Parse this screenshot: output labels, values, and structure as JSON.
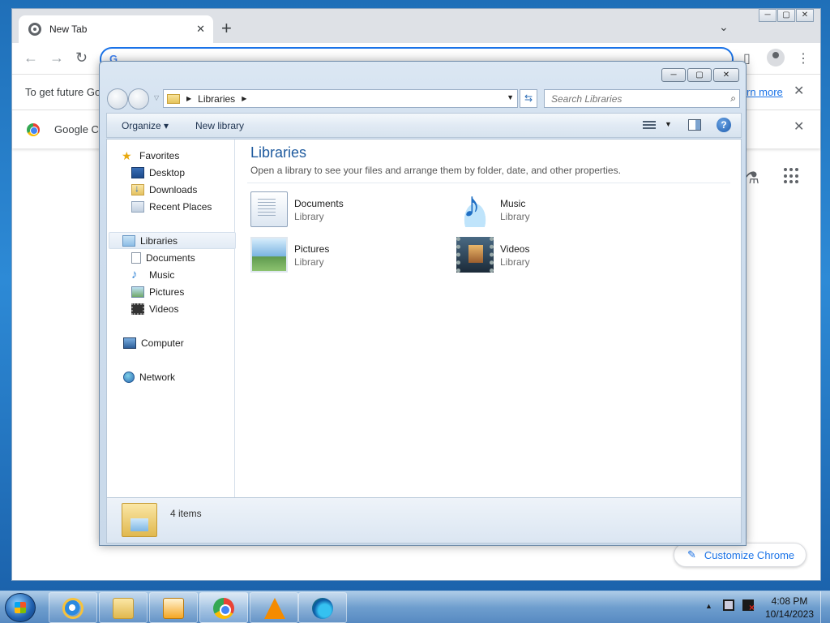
{
  "chrome": {
    "tab_title": "New Tab",
    "tab_close": "✕",
    "new_tab": "+",
    "tab_list": "⌄",
    "win_min": "─",
    "win_max": "▢",
    "win_close": "✕",
    "back": "←",
    "forward": "→",
    "reload": "↻",
    "omnibox_value": "",
    "infobar_text": "To get future Go",
    "infobar_link": "rn more",
    "infobar_close": "✕",
    "bookmark_text": "Google Cl",
    "bookmark_close": "✕",
    "labs_icon": "⚗",
    "customize_label": "Customize Chrome",
    "customize_icon": "✎"
  },
  "explorer": {
    "caption": {
      "min": "─",
      "max": "▢",
      "close": "✕"
    },
    "address": {
      "crumb": "Libraries"
    },
    "search_placeholder": "Search Libraries",
    "commands": {
      "organize": "Organize ▾",
      "new_library": "New library"
    },
    "nav": {
      "favorites": "Favorites",
      "desktop": "Desktop",
      "downloads": "Downloads",
      "recent": "Recent Places",
      "libraries": "Libraries",
      "documents": "Documents",
      "music": "Music",
      "pictures": "Pictures",
      "videos": "Videos",
      "computer": "Computer",
      "network": "Network"
    },
    "content": {
      "heading": "Libraries",
      "subtitle": "Open a library to see your files and arrange them by folder, date, and other properties.",
      "items": [
        {
          "name": "Documents",
          "type": "Library"
        },
        {
          "name": "Music",
          "type": "Library"
        },
        {
          "name": "Pictures",
          "type": "Library"
        },
        {
          "name": "Videos",
          "type": "Library"
        }
      ]
    },
    "status": {
      "count": "4 items"
    }
  },
  "taskbar": {
    "time": "4:08 PM",
    "date": "10/14/2023"
  }
}
